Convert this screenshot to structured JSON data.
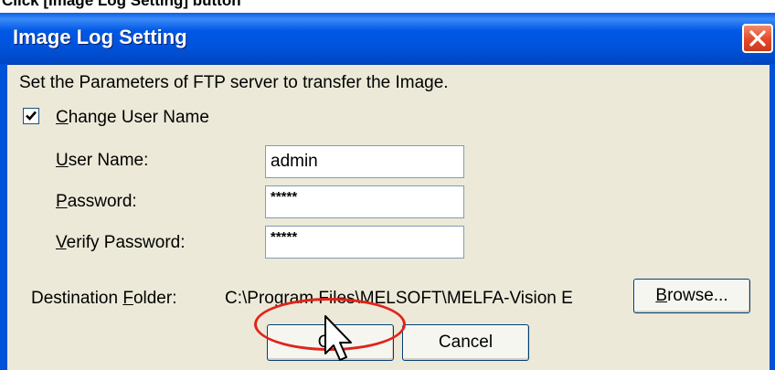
{
  "top_caption": "Click [Image Log Setting] button",
  "dialog": {
    "title": "Image Log Setting",
    "description": "Set the Parameters of FTP server to transfer the Image.",
    "change_user_name": {
      "checked": true,
      "label_mnemonic": "C",
      "label_rest": "hange User Name"
    },
    "user_name": {
      "label_mnemonic": "U",
      "label_rest": "ser Name:",
      "value": "admin"
    },
    "password": {
      "label_mnemonic": "P",
      "label_rest": "assword:",
      "value": "*****"
    },
    "verify_password": {
      "label_mnemonic": "V",
      "label_rest": "erify Password:",
      "value": "*****"
    },
    "destination": {
      "label_prefix": "Destination ",
      "label_mnemonic": "F",
      "label_rest": "older:",
      "path": "C:\\Program Files\\MELSOFT\\MELFA-Vision E"
    },
    "browse": {
      "mnemonic": "B",
      "rest": "rowse..."
    },
    "ok_label": "OK",
    "cancel_label": "Cancel"
  },
  "colors": {
    "title_bar": "#0052D9",
    "dialog_face": "#ECE9D8",
    "highlight_ring": "#E2231A"
  },
  "icons": [
    "close-icon",
    "checkmark-icon",
    "mouse-cursor-icon"
  ]
}
